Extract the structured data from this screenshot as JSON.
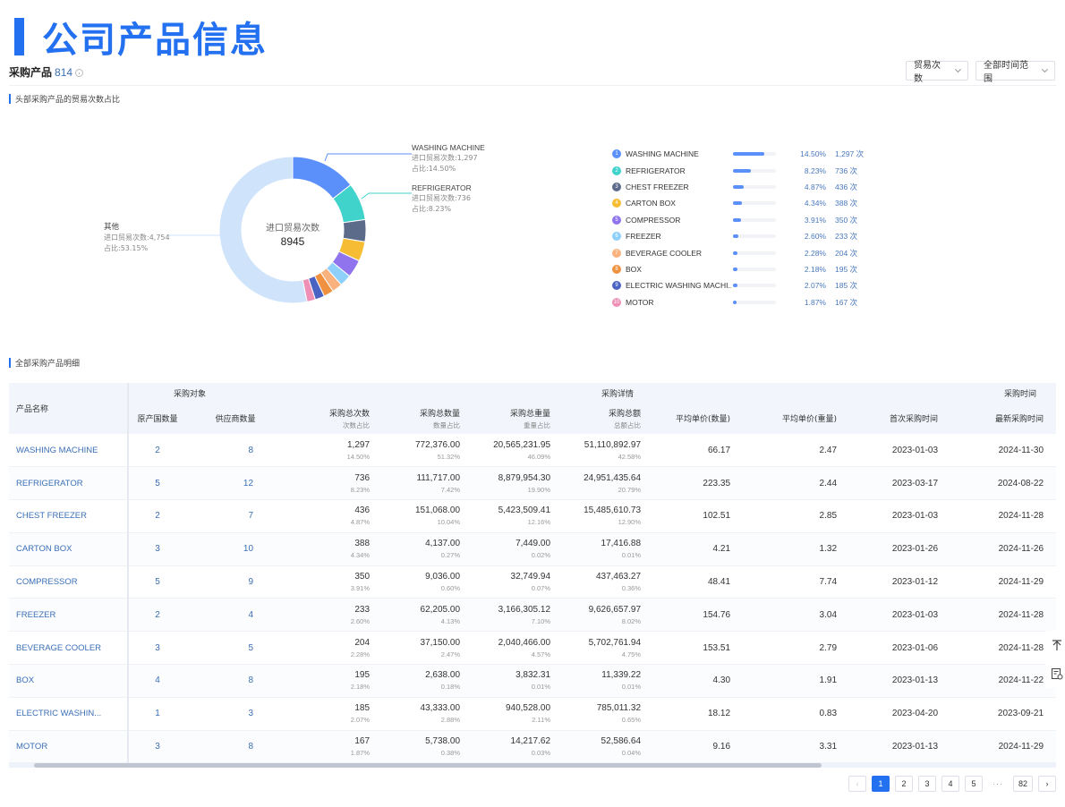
{
  "page": {
    "title": "公司产品信息"
  },
  "header": {
    "label": "采购产品",
    "count": "814",
    "metric_select": "贸易次数",
    "range_select": "全部时间范围"
  },
  "section_chart": {
    "title": "头部采购产品的贸易次数占比"
  },
  "section_table": {
    "title": "全部采购产品明细"
  },
  "chart_data": {
    "type": "pie",
    "variant": "donut",
    "center_label": "进口贸易次数",
    "center_value": "8945",
    "total": 8945,
    "slices": [
      {
        "name": "WASHING MACHINE",
        "value": 1297,
        "percent": 14.5,
        "color": "#5b8ff9"
      },
      {
        "name": "REFRIGERATOR",
        "value": 736,
        "percent": 8.23,
        "color": "#3fd3cb"
      },
      {
        "name": "CHEST FREEZER",
        "value": 436,
        "percent": 4.87,
        "color": "#5d6b8a"
      },
      {
        "name": "CARTON BOX",
        "value": 388,
        "percent": 4.34,
        "color": "#f6bd34"
      },
      {
        "name": "COMPRESSOR",
        "value": 350,
        "percent": 3.91,
        "color": "#8f74ed"
      },
      {
        "name": "FREEZER",
        "value": 233,
        "percent": 2.6,
        "color": "#8fd0fa"
      },
      {
        "name": "BEVERAGE COOLER",
        "value": 204,
        "percent": 2.28,
        "color": "#f9b27e"
      },
      {
        "name": "BOX",
        "value": 195,
        "percent": 2.18,
        "color": "#f09140"
      },
      {
        "name": "ELECTRIC WASHING MACHINE",
        "value": 185,
        "percent": 2.07,
        "color": "#4a62c2"
      },
      {
        "name": "MOTOR",
        "value": 167,
        "percent": 1.87,
        "color": "#ef8fb6"
      },
      {
        "name": "其他",
        "value": 4754,
        "percent": 53.15,
        "color": "#cfe3fb"
      }
    ],
    "callouts": [
      {
        "name": "WASHING MACHINE",
        "line1": "进口贸易次数:1,297",
        "line2": "占比:14.50%"
      },
      {
        "name": "REFRIGERATOR",
        "line1": "进口贸易次数:736",
        "line2": "占比:8.23%"
      },
      {
        "name": "其他",
        "line1": "进口贸易次数:4,754",
        "line2": "占比:53.15%"
      }
    ]
  },
  "legend": [
    {
      "idx": "1",
      "name": "WASHING MACHINE",
      "pct": "14.50%",
      "cnt": "1,297 次",
      "share": 0.145,
      "color": "#5b8ff9"
    },
    {
      "idx": "2",
      "name": "REFRIGERATOR",
      "pct": "8.23%",
      "cnt": "736 次",
      "share": 0.0823,
      "color": "#3fd3cb"
    },
    {
      "idx": "3",
      "name": "CHEST FREEZER",
      "pct": "4.87%",
      "cnt": "436 次",
      "share": 0.0487,
      "color": "#5d6b8a"
    },
    {
      "idx": "4",
      "name": "CARTON BOX",
      "pct": "4.34%",
      "cnt": "388 次",
      "share": 0.0434,
      "color": "#f6bd34"
    },
    {
      "idx": "5",
      "name": "COMPRESSOR",
      "pct": "3.91%",
      "cnt": "350 次",
      "share": 0.0391,
      "color": "#8f74ed"
    },
    {
      "idx": "6",
      "name": "FREEZER",
      "pct": "2.60%",
      "cnt": "233 次",
      "share": 0.026,
      "color": "#8fd0fa"
    },
    {
      "idx": "7",
      "name": "BEVERAGE COOLER",
      "pct": "2.28%",
      "cnt": "204 次",
      "share": 0.0228,
      "color": "#f9b27e"
    },
    {
      "idx": "8",
      "name": "BOX",
      "pct": "2.18%",
      "cnt": "195 次",
      "share": 0.0218,
      "color": "#f09140"
    },
    {
      "idx": "9",
      "name": "ELECTRIC WASHING MACHI...",
      "pct": "2.07%",
      "cnt": "185 次",
      "share": 0.0207,
      "color": "#4a62c2"
    },
    {
      "idx": "10",
      "name": "MOTOR",
      "pct": "1.87%",
      "cnt": "167 次",
      "share": 0.0187,
      "color": "#ef8fb6"
    }
  ],
  "table": {
    "group_headers": {
      "name": "产品名称",
      "target": "采购对象",
      "detail": "采购详情",
      "time": "采购时间"
    },
    "columns": [
      {
        "title": "原产国数量"
      },
      {
        "title": "供应商数量"
      },
      {
        "title": "采购总次数",
        "sub": "次数占比"
      },
      {
        "title": "采购总数量",
        "sub": "数量占比"
      },
      {
        "title": "采购总重量",
        "sub": "重量占比"
      },
      {
        "title": "采购总额",
        "sub": "总额占比"
      },
      {
        "title": "平均单价(数量)"
      },
      {
        "title": "平均单价(重量)"
      },
      {
        "title": "首次采购时间"
      },
      {
        "title": "最新采购时间"
      }
    ],
    "rows": [
      {
        "name": "WASHING MACHINE",
        "origins": "2",
        "suppliers": "8",
        "times": "1,297",
        "times_pct": "14.50%",
        "qty": "772,376.00",
        "qty_pct": "51.32%",
        "weight": "20,565,231.95",
        "weight_pct": "46.09%",
        "amount": "51,110,892.97",
        "amount_pct": "42.58%",
        "avg_qty": "66.17",
        "avg_wt": "2.47",
        "first": "2023-01-03",
        "latest": "2024-11-30"
      },
      {
        "name": "REFRIGERATOR",
        "origins": "5",
        "suppliers": "12",
        "times": "736",
        "times_pct": "8.23%",
        "qty": "111,717.00",
        "qty_pct": "7.42%",
        "weight": "8,879,954.30",
        "weight_pct": "19.90%",
        "amount": "24,951,435.64",
        "amount_pct": "20.79%",
        "avg_qty": "223.35",
        "avg_wt": "2.44",
        "first": "2023-03-17",
        "latest": "2024-08-22"
      },
      {
        "name": "CHEST FREEZER",
        "origins": "2",
        "suppliers": "7",
        "times": "436",
        "times_pct": "4.87%",
        "qty": "151,068.00",
        "qty_pct": "10.04%",
        "weight": "5,423,509.41",
        "weight_pct": "12.16%",
        "amount": "15,485,610.73",
        "amount_pct": "12.90%",
        "avg_qty": "102.51",
        "avg_wt": "2.85",
        "first": "2023-01-03",
        "latest": "2024-11-28"
      },
      {
        "name": "CARTON BOX",
        "origins": "3",
        "suppliers": "10",
        "times": "388",
        "times_pct": "4.34%",
        "qty": "4,137.00",
        "qty_pct": "0.27%",
        "weight": "7,449.00",
        "weight_pct": "0.02%",
        "amount": "17,416.88",
        "amount_pct": "0.01%",
        "avg_qty": "4.21",
        "avg_wt": "1.32",
        "first": "2023-01-26",
        "latest": "2024-11-26"
      },
      {
        "name": "COMPRESSOR",
        "origins": "5",
        "suppliers": "9",
        "times": "350",
        "times_pct": "3.91%",
        "qty": "9,036.00",
        "qty_pct": "0.60%",
        "weight": "32,749.94",
        "weight_pct": "0.07%",
        "amount": "437,463.27",
        "amount_pct": "0.36%",
        "avg_qty": "48.41",
        "avg_wt": "7.74",
        "first": "2023-01-12",
        "latest": "2024-11-29"
      },
      {
        "name": "FREEZER",
        "origins": "2",
        "suppliers": "4",
        "times": "233",
        "times_pct": "2.60%",
        "qty": "62,205.00",
        "qty_pct": "4.13%",
        "weight": "3,166,305.12",
        "weight_pct": "7.10%",
        "amount": "9,626,657.97",
        "amount_pct": "8.02%",
        "avg_qty": "154.76",
        "avg_wt": "3.04",
        "first": "2023-01-03",
        "latest": "2024-11-28"
      },
      {
        "name": "BEVERAGE COOLER",
        "origins": "3",
        "suppliers": "5",
        "times": "204",
        "times_pct": "2.28%",
        "qty": "37,150.00",
        "qty_pct": "2.47%",
        "weight": "2,040,466.00",
        "weight_pct": "4.57%",
        "amount": "5,702,761.94",
        "amount_pct": "4.75%",
        "avg_qty": "153.51",
        "avg_wt": "2.79",
        "first": "2023-01-06",
        "latest": "2024-11-28"
      },
      {
        "name": "BOX",
        "origins": "4",
        "suppliers": "8",
        "times": "195",
        "times_pct": "2.18%",
        "qty": "2,638.00",
        "qty_pct": "0.18%",
        "weight": "3,832.31",
        "weight_pct": "0.01%",
        "amount": "11,339.22",
        "amount_pct": "0.01%",
        "avg_qty": "4.30",
        "avg_wt": "1.91",
        "first": "2023-01-13",
        "latest": "2024-11-22"
      },
      {
        "name": "ELECTRIC WASHIN...",
        "origins": "1",
        "suppliers": "3",
        "times": "185",
        "times_pct": "2.07%",
        "qty": "43,333.00",
        "qty_pct": "2.88%",
        "weight": "940,528.00",
        "weight_pct": "2.11%",
        "amount": "785,011.32",
        "amount_pct": "0.65%",
        "avg_qty": "18.12",
        "avg_wt": "0.83",
        "first": "2023-04-20",
        "latest": "2023-09-21"
      },
      {
        "name": "MOTOR",
        "origins": "3",
        "suppliers": "8",
        "times": "167",
        "times_pct": "1.87%",
        "qty": "5,738.00",
        "qty_pct": "0.38%",
        "weight": "14,217.62",
        "weight_pct": "0.03%",
        "amount": "52,586.64",
        "amount_pct": "0.04%",
        "avg_qty": "9.16",
        "avg_wt": "3.31",
        "first": "2023-01-13",
        "latest": "2024-11-29"
      }
    ]
  },
  "pagination": {
    "pages": [
      "1",
      "2",
      "3",
      "4",
      "5"
    ],
    "ellipsis": "···",
    "last": "82",
    "current": "1"
  },
  "float_buttons": [
    {
      "icon": "back-to-top-icon"
    },
    {
      "icon": "feedback-icon"
    }
  ]
}
